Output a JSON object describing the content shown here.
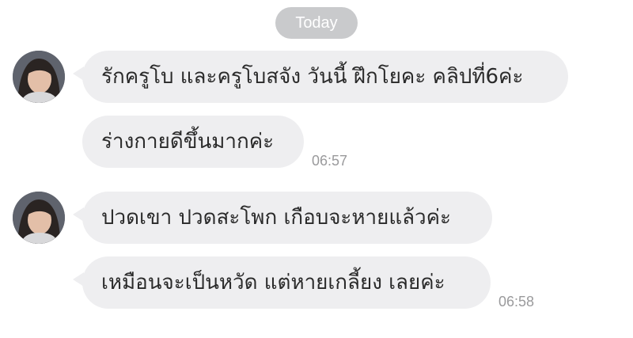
{
  "chat": {
    "date_label": "Today",
    "groups": [
      {
        "messages": [
          "รักครูโบ และครูโบสจัง วันนี้ ฝึกโยคะ คลิปที่6ค่ะ",
          "ร่างกายดีขึ้นมากค่ะ"
        ],
        "time": "06:57"
      },
      {
        "messages": [
          "ปวดเขา ปวดสะโพก เกือบจะหายแล้วค่ะ",
          "เหมือนจะเป็นหวัด แต่หายเกลี้ยง เลยค่ะ"
        ],
        "time": "06:58"
      }
    ]
  }
}
